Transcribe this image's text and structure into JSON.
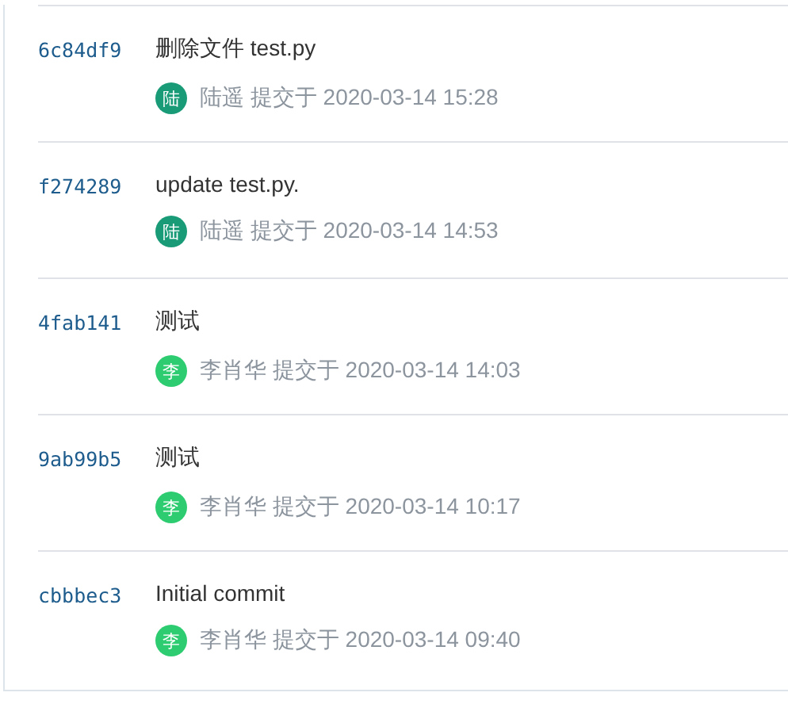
{
  "commits": [
    {
      "hash": "6c84df9",
      "message": "删除文件 test.py",
      "avatar": "陆",
      "color": "#1a9b78",
      "meta": "陆遥 提交于 2020-03-14 15:28"
    },
    {
      "hash": "f274289",
      "message": "update test.py.",
      "avatar": "陆",
      "color": "#1a9b78",
      "meta": "陆遥 提交于 2020-03-14 14:53"
    },
    {
      "hash": "4fab141",
      "message": "测试",
      "avatar": "李",
      "color": "#2ecc71",
      "meta": "李肖华 提交于 2020-03-14 14:03"
    },
    {
      "hash": "9ab99b5",
      "message": "测试",
      "avatar": "李",
      "color": "#2ecc71",
      "meta": "李肖华 提交于 2020-03-14 10:17"
    },
    {
      "hash": "cbbbec3",
      "message": "Initial commit",
      "avatar": "李",
      "color": "#2ecc71",
      "meta": "李肖华 提交于 2020-03-14 09:40"
    }
  ]
}
